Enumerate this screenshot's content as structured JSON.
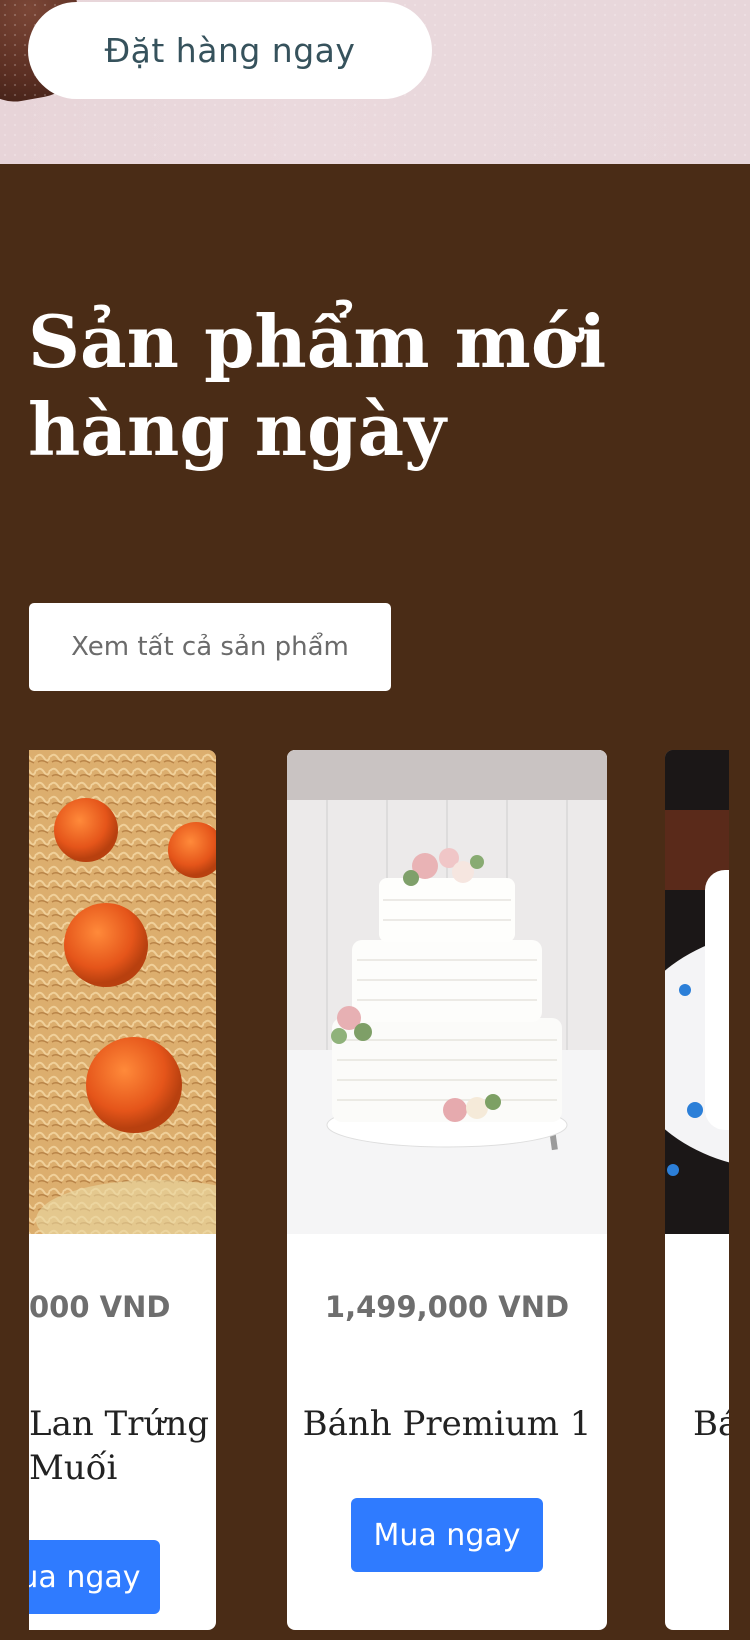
{
  "hero": {
    "order_button_label": "Đặt hàng ngay"
  },
  "section": {
    "title": "Sản phẩm mới hàng ngày",
    "view_all_label": "Xem tất cả sản phẩm"
  },
  "products": [
    {
      "price": "000 VND",
      "name": "Lan Trứng Muối",
      "buy_label": "ua ngay"
    },
    {
      "price": "1,499,000 VND",
      "name": "Bánh Premium 1",
      "buy_label": "Mua ngay"
    },
    {
      "name": "Bá"
    }
  ],
  "colors": {
    "section_bg": "#4a2c16",
    "buy_button": "#2f7bff",
    "hero_bg": "#e7d4d8"
  }
}
